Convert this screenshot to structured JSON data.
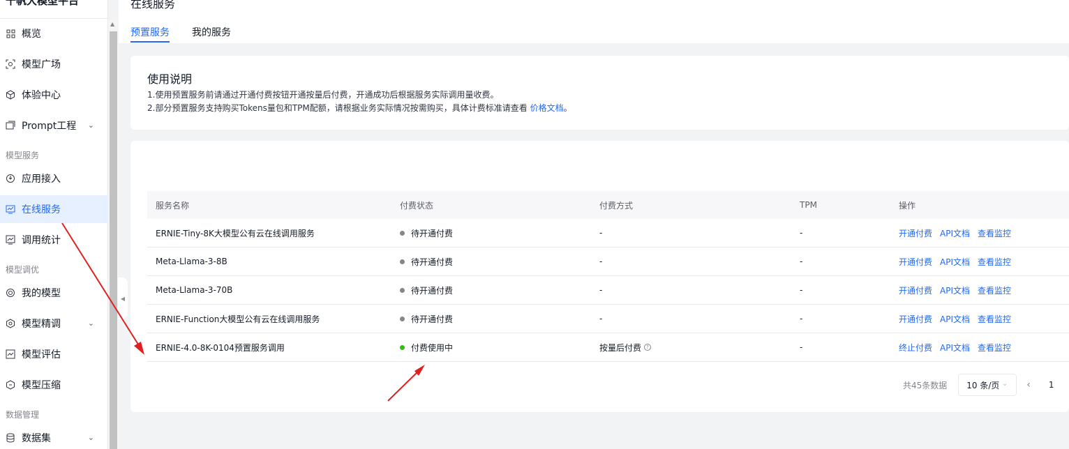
{
  "app": {
    "brand": "千帆大模型平台"
  },
  "sidebar": {
    "items": [
      {
        "label": "概览",
        "icon": "grid-icon"
      },
      {
        "label": "模型广场",
        "icon": "model-square-icon"
      },
      {
        "label": "体验中心",
        "icon": "cube-icon"
      },
      {
        "label": "Prompt工程",
        "icon": "prompt-icon"
      },
      {
        "label": "应用接入",
        "icon": "plug-icon"
      },
      {
        "label": "在线服务",
        "icon": "monitor-icon"
      },
      {
        "label": "调用统计",
        "icon": "chart-icon"
      },
      {
        "label": "我的模型",
        "icon": "target-icon"
      },
      {
        "label": "模型精调",
        "icon": "hex-icon"
      },
      {
        "label": "模型评估",
        "icon": "eval-icon"
      },
      {
        "label": "模型压缩",
        "icon": "compress-icon"
      },
      {
        "label": "数据集",
        "icon": "database-icon"
      }
    ],
    "groups": [
      "模型服务",
      "模型调优",
      "数据管理"
    ]
  },
  "header": {
    "title": "在线服务",
    "tabs": [
      {
        "label": "预置服务",
        "active": true
      },
      {
        "label": "我的服务",
        "active": false
      }
    ]
  },
  "usage": {
    "title": "使用说明",
    "line1": "1.使用预置服务前请通过开通付费按钮开通按量后付费，开通成功后根据服务实际调用量收费。",
    "line2_prefix": "2.部分预置服务支持购买Tokens量包和TPM配额，请根据业务实际情况按需购买，具体计费标准请查看 ",
    "line2_link": "价格文档",
    "line2_suffix": "。"
  },
  "table": {
    "columns": [
      "服务名称",
      "付费状态",
      "付费方式",
      "TPM",
      "操作"
    ],
    "rows": [
      {
        "name": "ERNIE-Tiny-8K大模型公有云在线调用服务",
        "status": "待开通付费",
        "method": "-",
        "tpm": "-",
        "op1": "开通付费",
        "op2": "API文档",
        "op3": "查看监控"
      },
      {
        "name": "Meta-Llama-3-8B",
        "status": "待开通付费",
        "method": "-",
        "tpm": "-",
        "op1": "开通付费",
        "op2": "API文档",
        "op3": "查看监控"
      },
      {
        "name": "Meta-Llama-3-70B",
        "status": "待开通付费",
        "method": "-",
        "tpm": "-",
        "op1": "开通付费",
        "op2": "API文档",
        "op3": "查看监控"
      },
      {
        "name": "ERNIE-Function大模型公有云在线调用服务",
        "status": "待开通付费",
        "method": "-",
        "tpm": "-",
        "op1": "开通付费",
        "op2": "API文档",
        "op3": "查看监控"
      },
      {
        "name": "ERNIE-4.0-8K-0104预置服务调用",
        "status": "付费使用中",
        "method": "按量后付费",
        "tpm": "-",
        "op1": "终止付费",
        "op2": "API文档",
        "op3": "查看监控"
      }
    ]
  },
  "pagination": {
    "total": "共45条数据",
    "page_size": "10 条/页",
    "current": "1"
  },
  "colors": {
    "accent": "#2468f2",
    "status_pending": "#84868c",
    "status_active": "#30bf13",
    "annotation_arrow": "#e02020"
  }
}
